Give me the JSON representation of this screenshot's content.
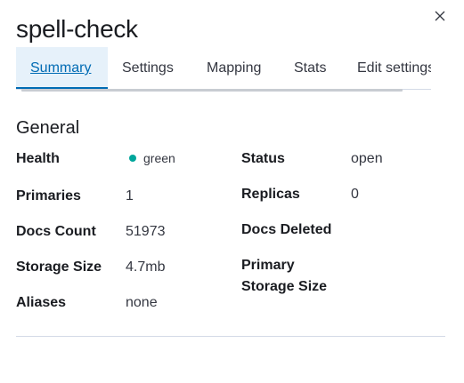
{
  "flyout": {
    "title": "spell-check",
    "close_icon": "close-icon"
  },
  "tabs": [
    {
      "label": "Summary",
      "selected": true
    },
    {
      "label": "Settings",
      "selected": false
    },
    {
      "label": "Mapping",
      "selected": false
    },
    {
      "label": "Stats",
      "selected": false
    },
    {
      "label": "Edit settings",
      "selected": false
    }
  ],
  "general": {
    "title": "General",
    "health": {
      "label": "Health",
      "value": "green",
      "color": "#00a69b",
      "icon": "dot-icon"
    },
    "status": {
      "label": "Status",
      "value": "open"
    },
    "primaries": {
      "label": "Primaries",
      "value": "1"
    },
    "replicas": {
      "label": "Replicas",
      "value": "0"
    },
    "docs_count": {
      "label": "Docs Count",
      "value": "51973"
    },
    "docs_deleted": {
      "label": "Docs Deleted",
      "value": ""
    },
    "storage_size": {
      "label": "Storage Size",
      "value": "4.7mb"
    },
    "primary_storage_size": {
      "label_line1": "Primary",
      "label_line2": "Storage Size",
      "value": ""
    },
    "aliases": {
      "label": "Aliases",
      "value": "none"
    }
  },
  "colors": {
    "accent": "#006bb4",
    "selected_tab_bg": "#e6f1fa",
    "text": "#343741",
    "heading": "#1a1c21",
    "divider": "#d3dae6"
  }
}
